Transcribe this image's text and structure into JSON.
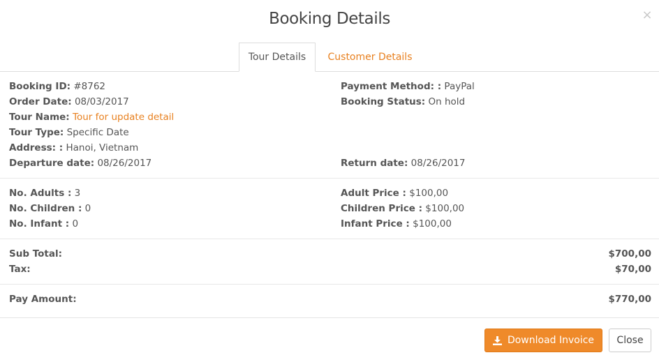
{
  "modal": {
    "title": "Booking Details",
    "close_glyph": "×"
  },
  "tabs": [
    {
      "label": "Tour Details",
      "active": true
    },
    {
      "label": "Customer Details",
      "active": false
    }
  ],
  "booking": {
    "id_label": "Booking ID:",
    "id_value": "#8762",
    "order_date_label": "Order Date:",
    "order_date_value": "08/03/2017",
    "tour_name_label": "Tour Name:",
    "tour_name_value": "Tour for update detail",
    "tour_type_label": "Tour Type:",
    "tour_type_value": "Specific Date",
    "address_label": "Address: :",
    "address_value": "Hanoi, Vietnam",
    "departure_label": "Departure date:",
    "departure_value": "08/26/2017",
    "payment_method_label": "Payment Method: :",
    "payment_method_value": "PayPal",
    "status_label": "Booking Status:",
    "status_value": "On hold",
    "return_label": "Return date:",
    "return_value": "08/26/2017"
  },
  "guests": {
    "adults_label": "No. Adults :",
    "adults_value": "3",
    "children_label": "No. Children :",
    "children_value": "0",
    "infant_label": "No. Infant :",
    "infant_value": "0",
    "adult_price_label": "Adult Price :",
    "adult_price_value": "$100,00",
    "children_price_label": "Children Price :",
    "children_price_value": "$100,00",
    "infant_price_label": "Infant Price :",
    "infant_price_value": "$100,00"
  },
  "totals": {
    "subtotal_label": "Sub Total:",
    "subtotal_value": "$700,00",
    "tax_label": "Tax:",
    "tax_value": "$70,00",
    "pay_label": "Pay Amount:",
    "pay_value": "$770,00"
  },
  "footer": {
    "download_label": "Download Invoice",
    "download_icon": "download-icon",
    "close_label": "Close"
  },
  "colors": {
    "accent": "#ef8a2a",
    "link": "#e8801f",
    "text": "#555555"
  }
}
